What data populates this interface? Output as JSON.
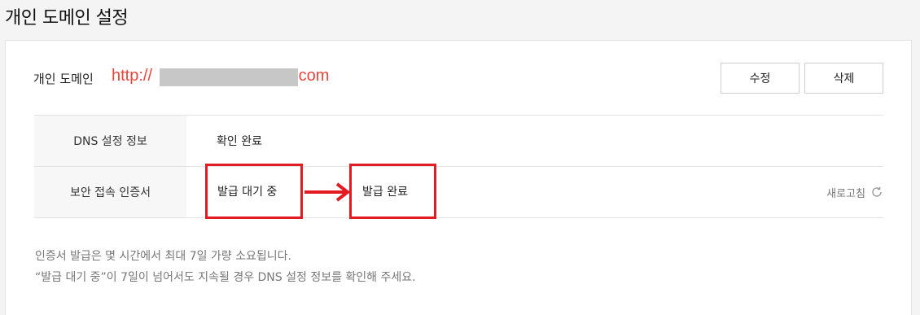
{
  "page_title": "개인 도메인 설정",
  "domain": {
    "label": "개인 도메인",
    "url_prefix": "http://",
    "url_suffix": ".com"
  },
  "buttons": {
    "edit": "수정",
    "delete": "삭제"
  },
  "table": {
    "rows": [
      {
        "header": "DNS 설정 정보",
        "value": "확인 완료"
      },
      {
        "header": "보안 접속 인증서",
        "value_before": "발급 대기 중",
        "value_after": "발급 완료"
      }
    ],
    "refresh_label": "새로고침"
  },
  "notes": [
    "인증서 발급은 몇 시간에서 최대 7일 가량 소요됩니다.",
    "“발급 대기 중”이 7일이 넘어서도 지속될 경우 DNS 설정 정보를 확인해 주세요."
  ],
  "colors": {
    "accent_red": "#e8453c",
    "annotation_red": "#e31b23"
  }
}
